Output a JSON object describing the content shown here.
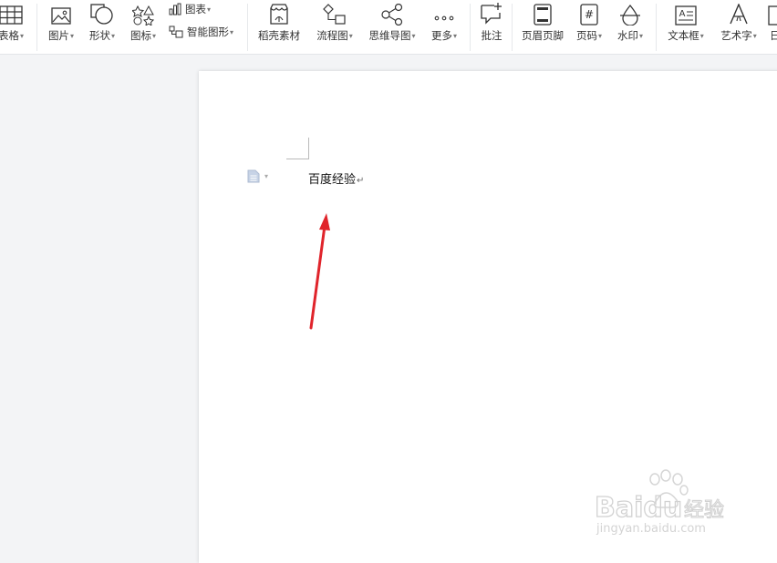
{
  "ribbon": {
    "table": "表格",
    "picture": "图片",
    "shape": "形状",
    "icon": "图标",
    "chart": "图表",
    "smart_art": "智能图形",
    "daoke_material": "稻壳素材",
    "flowchart": "流程图",
    "mindmap": "思维导图",
    "more": "更多",
    "comment": "批注",
    "header_footer": "页眉页脚",
    "page_number": "页码",
    "watermark": "水印",
    "text_box": "文本框",
    "word_art": "艺术字",
    "date_partial": "日"
  },
  "document": {
    "text": "百度经验",
    "paragraph_mark": "↵"
  },
  "watermark": {
    "brand": "Baidu",
    "brand_suffix": "经验",
    "url": "jingyan.baidu.com"
  },
  "colors": {
    "arrow": "#e0242b",
    "page": "#ffffff",
    "background": "#f3f4f6"
  }
}
